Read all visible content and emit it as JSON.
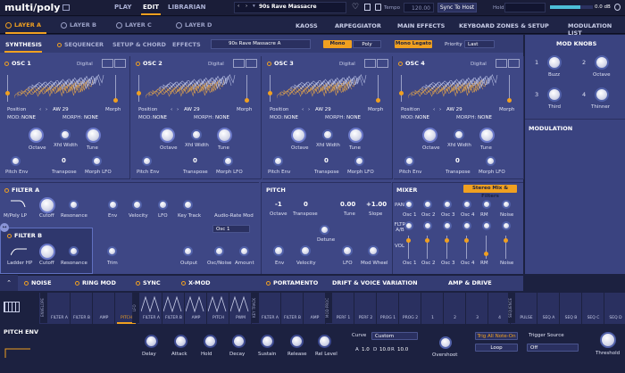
{
  "app": {
    "logo": "multi/poly",
    "modes": [
      "PLAY",
      "EDIT",
      "LIBRARIAN"
    ],
    "preset": "90s Rave Massacre",
    "tempo_label": "Tempo",
    "tempo_value": "120.00",
    "sync": "Sync To Host",
    "hold": "Hold",
    "volume": "0.0 dB",
    "volume_level": 0.7
  },
  "layers": [
    "LAYER A",
    "LAYER B",
    "LAYER C",
    "LAYER D"
  ],
  "right_tabs": [
    "KAOSS",
    "ARPEGGIATOR",
    "MAIN EFFECTS",
    "KEYBOARD ZONES & SETUP",
    "MODULATION LIST"
  ],
  "subtabs": [
    "SYNTHESIS",
    "SEQUENCER",
    "SETUP & CHORD",
    "EFFECTS"
  ],
  "subpreset": "90s Rave Massacre A",
  "voice": {
    "mono": "Mono",
    "poly": "Poly",
    "legato": "Mono Legato",
    "priority_label": "Priority",
    "priority_value": "Last"
  },
  "osc": [
    {
      "title": "OSC 1",
      "type": "Digital",
      "pos_label": "Position",
      "wave": "AW 29",
      "morph": "Morph",
      "mod": "MOD:",
      "mod_val": "NONE",
      "morphm": "MORPH:",
      "morph_val": "NONE",
      "k1": "Octave",
      "k2": "Xfd Width",
      "k3": "Tune",
      "k4": "Pitch Env",
      "k5": "Transpose",
      "k5v": "0",
      "k6": "Morph LFO"
    },
    {
      "title": "OSC 2",
      "type": "Digital",
      "pos_label": "Position",
      "wave": "AW 29",
      "morph": "Morph",
      "mod": "MOD:",
      "mod_val": "NONE",
      "morphm": "MORPH:",
      "morph_val": "NONE",
      "k1": "Octave",
      "k2": "Xfd Width",
      "k3": "Tune",
      "k4": "Pitch Env",
      "k5": "Transpose",
      "k5v": "0",
      "k6": "Morph LFO"
    },
    {
      "title": "OSC 3",
      "type": "Digital",
      "pos_label": "Position",
      "wave": "AW 29",
      "morph": "Morph",
      "mod": "MOD:",
      "mod_val": "NONE",
      "morphm": "MORPH:",
      "morph_val": "NONE",
      "k1": "Octave",
      "k2": "Xfd Width",
      "k3": "Tune",
      "k4": "Pitch Env",
      "k5": "Transpose",
      "k5v": "0",
      "k6": "Morph LFO"
    },
    {
      "title": "OSC 4",
      "type": "Digital",
      "pos_label": "Position",
      "wave": "AW 29",
      "morph": "Morph",
      "mod": "MOD:",
      "mod_val": "NONE",
      "morphm": "MORPH:",
      "morph_val": "NONE",
      "k1": "Octave",
      "k2": "Xfd Width",
      "k3": "Tune",
      "k4": "Pitch Env",
      "k5": "Transpose",
      "k5v": "0",
      "k6": "Morph LFO"
    }
  ],
  "filterA": {
    "title": "FILTER A",
    "type": "M/Poly LP",
    "labels": [
      "Cutoff",
      "Resonance",
      "Env",
      "Velocity",
      "LFO",
      "Key Track",
      "Audio-Rate Mod"
    ],
    "osc_sel": "Osc 1"
  },
  "filterB": {
    "title": "FILTER B",
    "type": "Ladder HP",
    "labels": [
      "Cutoff",
      "Resonance",
      "Trim",
      "Output",
      "Osc/Noise",
      "Amount"
    ]
  },
  "pitch": {
    "title": "PITCH",
    "octave": "-1",
    "octave_label": "Octave",
    "transpose": "0",
    "transpose_label": "Transpose",
    "tune": "0.00",
    "tune_label": "Tune",
    "slope": "+1.00",
    "slope_label": "Slope",
    "detune": "Detune",
    "env": "Env",
    "velocity": "Velocity",
    "lfo": "LFO",
    "modwheel": "Mod Wheel"
  },
  "mixer": {
    "title": "MIXER",
    "stereo": "Stereo Mix & Filters",
    "pan": "PAN",
    "filt": "FLTR A/B",
    "vol": "VOL",
    "cols": [
      "Osc 1",
      "Osc 2",
      "Osc 3",
      "Osc 4",
      "RM",
      "Noise"
    ]
  },
  "modknobs": {
    "title": "MOD KNOBS",
    "knobs": [
      {
        "n": "1",
        "label": "Buzz"
      },
      {
        "n": "2",
        "label": "Octave"
      },
      {
        "n": "3",
        "label": "Third"
      },
      {
        "n": "4",
        "label": "Thinner"
      }
    ]
  },
  "modulation_title": "MODULATION",
  "bottom_tabs": [
    "NOISE",
    "RING MOD",
    "SYNC",
    "X-MOD",
    "PORTAMENTO",
    "DRIFT & VOICE VARIATION",
    "AMP & DRIVE"
  ],
  "modrow": {
    "envelope": "ENVELOPE",
    "env_items": [
      "FILTER A",
      "FILTER B",
      "AMP",
      "PITCH"
    ],
    "lfo": "LFO",
    "lfo_items": [
      "FILTER A",
      "FILTER B",
      "AMP",
      "PITCH",
      "PWM"
    ],
    "key": "KEY TRACK",
    "key_items": [
      "FILTER A",
      "FILTER B",
      "AMP"
    ],
    "mod": "MOD PROC",
    "mod_items": [
      "PERF 1",
      "PERF 2",
      "PROG 1",
      "PROG 2",
      "1",
      "2",
      "3",
      "4"
    ],
    "seq": "SEQUENCE",
    "seq_items": [
      "PULSE",
      "SEQ A",
      "SEQ B",
      "SEQ C",
      "SEQ D"
    ]
  },
  "env": {
    "title": "PITCH ENV",
    "knobs": [
      "Delay",
      "Attack",
      "Hold",
      "Decay",
      "Sustain",
      "Release",
      "Rel Level"
    ],
    "curve_label": "Curve",
    "curve_value": "Custom",
    "vals": [
      "A",
      "1.0",
      "D",
      "10.0",
      "R",
      "10.0"
    ],
    "trig": "Trig All Note-On",
    "loop": "Loop",
    "trig_src": "Trigger Source",
    "trig_val": "Off",
    "overshoot": "Overshoot",
    "threshold": "Threshold"
  }
}
